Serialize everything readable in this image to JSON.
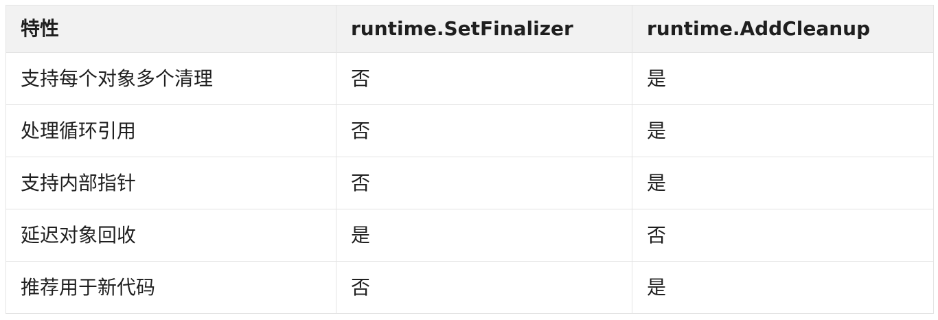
{
  "table": {
    "headers": [
      "特性",
      "runtime.SetFinalizer",
      "runtime.AddCleanup"
    ],
    "rows": [
      [
        "支持每个对象多个清理",
        "否",
        "是"
      ],
      [
        "处理循环引用",
        "否",
        "是"
      ],
      [
        "支持内部指针",
        "否",
        "是"
      ],
      [
        "延迟对象回收",
        "是",
        "否"
      ],
      [
        "推荐用于新代码",
        "否",
        "是"
      ]
    ]
  }
}
